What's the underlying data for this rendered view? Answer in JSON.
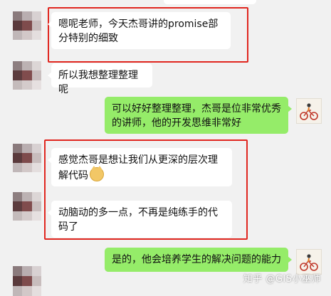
{
  "messages": [
    {
      "id": "m1",
      "side": "left",
      "text": "嗯呢老师，今天杰哥讲的promise部分特别的细致"
    },
    {
      "id": "m2",
      "side": "left",
      "text": "所以我想整理整理呢"
    },
    {
      "id": "m3",
      "side": "right",
      "text": "可以好好整理整理，杰哥是位非常优秀的讲师，他的开发思维非常好"
    },
    {
      "id": "m4",
      "side": "left",
      "text": "感觉杰哥是想让我们从更深的层次理解代码",
      "emoji": "cat-face-icon"
    },
    {
      "id": "m5",
      "side": "left",
      "text": "动脑动的多一点，不再是纯练手的代码了"
    },
    {
      "id": "m6",
      "side": "right",
      "text": "是的，他会培养学生的解决问题的能力"
    }
  ],
  "watermark": "知乎 @GIS小巫师",
  "colors": {
    "highlight": "#e0261f",
    "outgoing_bubble": "#95ec69",
    "incoming_bubble": "#ffffff",
    "background": "#f1f1f1"
  }
}
